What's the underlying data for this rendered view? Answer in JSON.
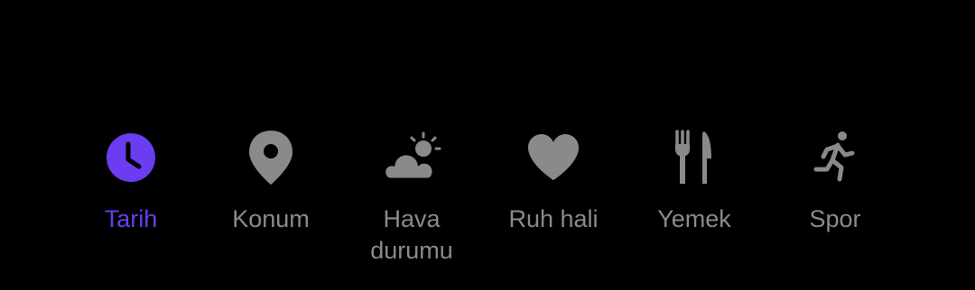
{
  "colors": {
    "background": "#000000",
    "active": "#6b3cf0",
    "inactive": "#8a8a8a"
  },
  "tabs": [
    {
      "label": "Tarih",
      "icon": "clock-icon",
      "selected": true
    },
    {
      "label": "Konum",
      "icon": "location-pin-icon",
      "selected": false
    },
    {
      "label": "Hava\ndurumu",
      "icon": "weather-partly-cloudy-icon",
      "selected": false
    },
    {
      "label": "Ruh hali",
      "icon": "heart-icon",
      "selected": false
    },
    {
      "label": "Yemek",
      "icon": "fork-knife-icon",
      "selected": false
    },
    {
      "label": "Spor",
      "icon": "running-person-icon",
      "selected": false
    }
  ]
}
